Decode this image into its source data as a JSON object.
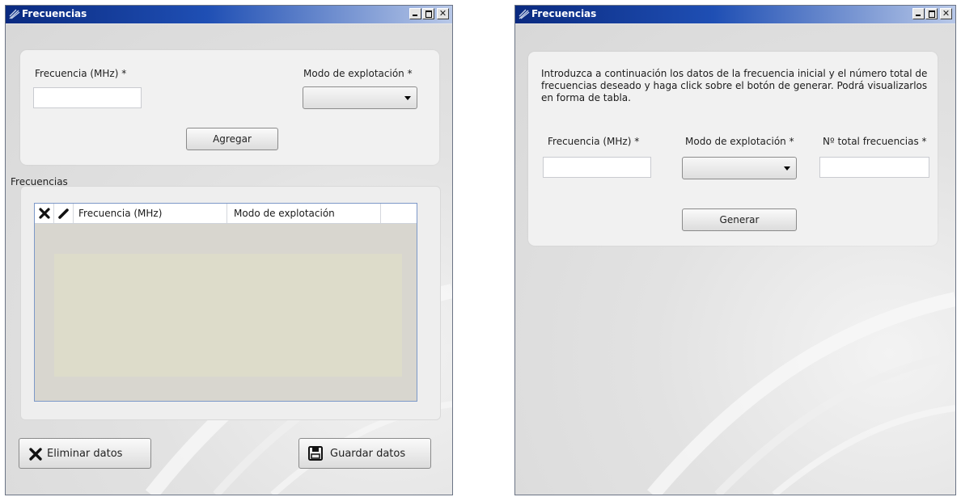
{
  "left_window": {
    "title": "Frecuencias",
    "form": {
      "frequency_label": "Frecuencia (MHz) *",
      "frequency_value": "",
      "mode_label": "Modo de explotación *",
      "mode_selected": "",
      "add_button": "Agregar"
    },
    "group": {
      "title": "Frecuencias",
      "columns": [
        "Frecuencia (MHz)",
        "Modo de explotación"
      ],
      "delete_col_icon": "x-icon",
      "edit_col_icon": "pencil-icon"
    },
    "buttons": {
      "delete_label": "Eliminar datos",
      "save_label": "Guardar datos"
    }
  },
  "right_window": {
    "title": "Frecuencias",
    "info_text": "Introduzca a continuación los datos de la frecuencia inicial y el número total de frecuencias deseado y haga click sobre el botón de generar. Podrá visualizarlos en forma de tabla.",
    "form": {
      "frequency_label": "Frecuencia (MHz) *",
      "frequency_value": "",
      "mode_label": "Modo de explotación *",
      "mode_selected": "",
      "total_label": "Nº total frecuencias *",
      "total_value": "",
      "generate_button": "Generar"
    }
  },
  "colors": {
    "titlebar_start": "#0a2a80",
    "titlebar_end": "#b8c8e8",
    "table_border": "#7c98c8",
    "table_empty_area": "#dddcca"
  }
}
